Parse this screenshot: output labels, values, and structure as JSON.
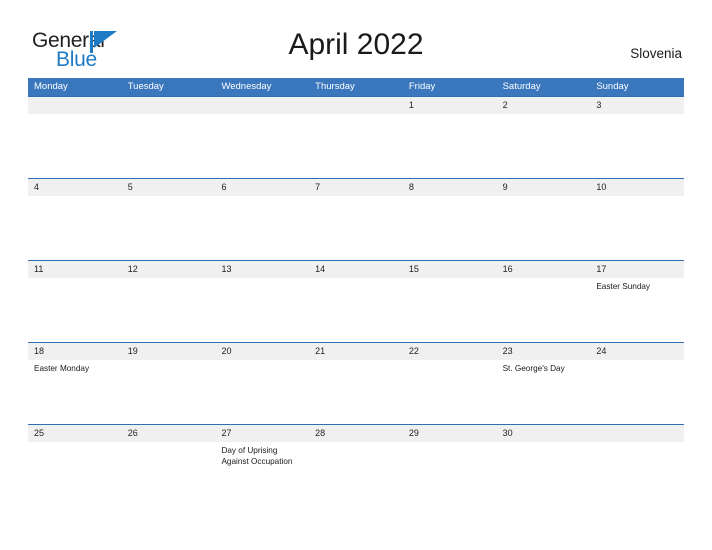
{
  "brand": {
    "name_part1": "General",
    "name_part2": "Blue",
    "mark": "triangle-flag-icon",
    "color_dark": "#231f20",
    "color_blue": "#1f7cc4"
  },
  "header": {
    "title": "April 2022",
    "region": "Slovenia"
  },
  "theme": {
    "header_bar": "#3b77bd",
    "row_strip": "#f0f0f0",
    "row_divider": "#2f6fb5",
    "background": "#ffffff",
    "text": "#1a1a1a"
  },
  "calendar": {
    "weekdays": [
      "Monday",
      "Tuesday",
      "Wednesday",
      "Thursday",
      "Friday",
      "Saturday",
      "Sunday"
    ],
    "weeks": [
      {
        "days": [
          {
            "date": "",
            "event": ""
          },
          {
            "date": "",
            "event": ""
          },
          {
            "date": "",
            "event": ""
          },
          {
            "date": "",
            "event": ""
          },
          {
            "date": "1",
            "event": ""
          },
          {
            "date": "2",
            "event": ""
          },
          {
            "date": "3",
            "event": ""
          }
        ]
      },
      {
        "days": [
          {
            "date": "4",
            "event": ""
          },
          {
            "date": "5",
            "event": ""
          },
          {
            "date": "6",
            "event": ""
          },
          {
            "date": "7",
            "event": ""
          },
          {
            "date": "8",
            "event": ""
          },
          {
            "date": "9",
            "event": ""
          },
          {
            "date": "10",
            "event": ""
          }
        ]
      },
      {
        "days": [
          {
            "date": "11",
            "event": ""
          },
          {
            "date": "12",
            "event": ""
          },
          {
            "date": "13",
            "event": ""
          },
          {
            "date": "14",
            "event": ""
          },
          {
            "date": "15",
            "event": ""
          },
          {
            "date": "16",
            "event": ""
          },
          {
            "date": "17",
            "event": "Easter Sunday"
          }
        ]
      },
      {
        "days": [
          {
            "date": "18",
            "event": "Easter Monday"
          },
          {
            "date": "19",
            "event": ""
          },
          {
            "date": "20",
            "event": ""
          },
          {
            "date": "21",
            "event": ""
          },
          {
            "date": "22",
            "event": ""
          },
          {
            "date": "23",
            "event": "St. George's Day"
          },
          {
            "date": "24",
            "event": ""
          }
        ]
      },
      {
        "days": [
          {
            "date": "25",
            "event": ""
          },
          {
            "date": "26",
            "event": ""
          },
          {
            "date": "27",
            "event": "Day of Uprising\nAgainst Occupation"
          },
          {
            "date": "28",
            "event": ""
          },
          {
            "date": "29",
            "event": ""
          },
          {
            "date": "30",
            "event": ""
          },
          {
            "date": "",
            "event": ""
          }
        ]
      }
    ]
  }
}
